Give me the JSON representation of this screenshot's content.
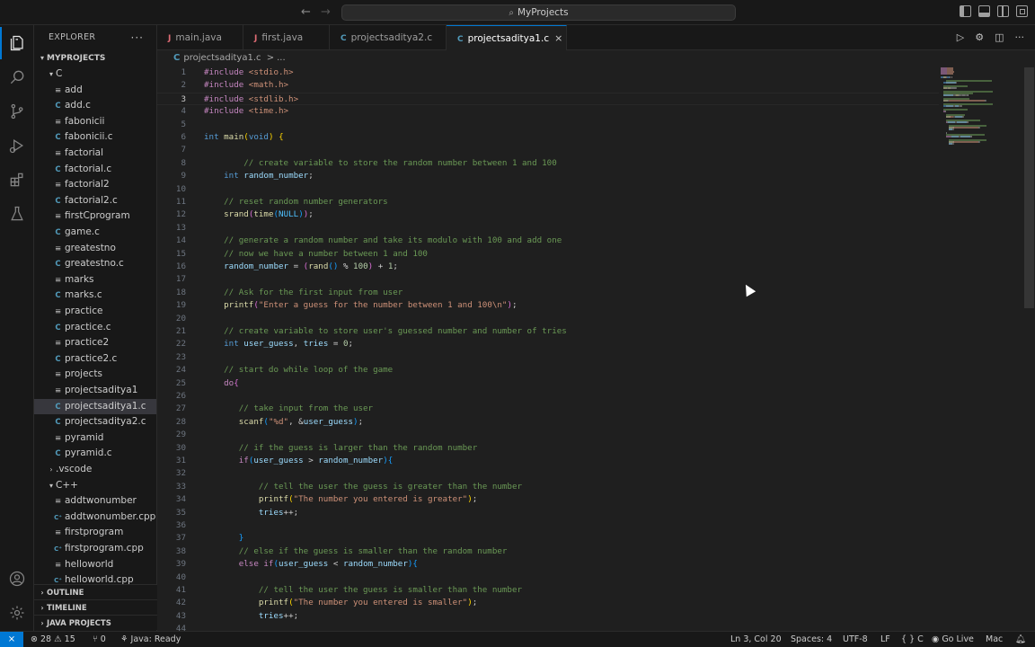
{
  "titlebar": {
    "search_text": "MyProjects",
    "back": "←",
    "forward": "→"
  },
  "activity": [
    "explorer",
    "search",
    "source-control",
    "run-debug",
    "extensions",
    "testing",
    "accounts",
    "manage"
  ],
  "sidebar": {
    "title": "EXPLORER",
    "more": "···",
    "root": "MYPROJECTS",
    "items": [
      {
        "label": "C",
        "kind": "folder",
        "open": true,
        "indent": 1
      },
      {
        "label": "add",
        "kind": "bin",
        "indent": 2
      },
      {
        "label": "add.c",
        "kind": "c",
        "indent": 2
      },
      {
        "label": "fabonicii",
        "kind": "bin",
        "indent": 2
      },
      {
        "label": "fabonicii.c",
        "kind": "c",
        "indent": 2
      },
      {
        "label": "factorial",
        "kind": "bin",
        "indent": 2
      },
      {
        "label": "factorial.c",
        "kind": "c",
        "indent": 2
      },
      {
        "label": "factorial2",
        "kind": "bin",
        "indent": 2
      },
      {
        "label": "factorial2.c",
        "kind": "c",
        "indent": 2
      },
      {
        "label": "firstCprogram",
        "kind": "bin",
        "indent": 2
      },
      {
        "label": "game.c",
        "kind": "c",
        "indent": 2
      },
      {
        "label": "greatestno",
        "kind": "bin",
        "indent": 2
      },
      {
        "label": "greatestno.c",
        "kind": "c",
        "indent": 2
      },
      {
        "label": "marks",
        "kind": "bin",
        "indent": 2
      },
      {
        "label": "marks.c",
        "kind": "c",
        "indent": 2
      },
      {
        "label": "practice",
        "kind": "bin",
        "indent": 2
      },
      {
        "label": "practice.c",
        "kind": "c",
        "indent": 2
      },
      {
        "label": "practice2",
        "kind": "bin",
        "indent": 2
      },
      {
        "label": "practice2.c",
        "kind": "c",
        "indent": 2
      },
      {
        "label": "projects",
        "kind": "bin",
        "indent": 2
      },
      {
        "label": "projectsaditya1",
        "kind": "bin",
        "indent": 2
      },
      {
        "label": "projectsaditya1.c",
        "kind": "c",
        "indent": 2,
        "selected": true
      },
      {
        "label": "projectsaditya2.c",
        "kind": "c",
        "indent": 2
      },
      {
        "label": "pyramid",
        "kind": "bin",
        "indent": 2
      },
      {
        "label": "pyramid.c",
        "kind": "c",
        "indent": 2
      },
      {
        "label": ".vscode",
        "kind": "folder",
        "open": false,
        "indent": 1
      },
      {
        "label": "C++",
        "kind": "folder",
        "open": true,
        "indent": 1
      },
      {
        "label": "addtwonumber",
        "kind": "bin",
        "indent": 2
      },
      {
        "label": "addtwonumber.cpp",
        "kind": "cpp",
        "indent": 2
      },
      {
        "label": "firstprogram",
        "kind": "bin",
        "indent": 2
      },
      {
        "label": "firstprogram.cpp",
        "kind": "cpp",
        "indent": 2
      },
      {
        "label": "helloworld",
        "kind": "bin",
        "indent": 2
      },
      {
        "label": "helloworld.cpp",
        "kind": "cpp",
        "indent": 2
      }
    ],
    "outline": "OUTLINE",
    "timeline": "TIMELINE",
    "java_projects": "JAVA PROJECTS"
  },
  "tabs": [
    {
      "label": "main.java",
      "icon": "J",
      "type": "java"
    },
    {
      "label": "first.java",
      "icon": "J",
      "type": "java"
    },
    {
      "label": "projectsaditya2.c",
      "icon": "C",
      "type": "c"
    },
    {
      "label": "projectsaditya1.c",
      "icon": "C",
      "type": "c",
      "active": true
    }
  ],
  "tab_close": "×",
  "breadcrumb": {
    "lang_icon": "C",
    "file": "projectsaditya1.c",
    "sep": ">",
    "more": "..."
  },
  "editor": {
    "current_line": 3,
    "lines": [
      [
        [
          "pp",
          "#include "
        ],
        [
          "str",
          "<stdio.h>"
        ]
      ],
      [
        [
          "pp",
          "#include "
        ],
        [
          "str",
          "<math.h>"
        ]
      ],
      [
        [
          "pp",
          "#include "
        ],
        [
          "str",
          "<stdlib.h>"
        ]
      ],
      [
        [
          "pp",
          "#include "
        ],
        [
          "str",
          "<time.h>"
        ]
      ],
      [],
      [
        [
          "kw",
          "int "
        ],
        [
          "fn",
          "main"
        ],
        [
          "paren",
          "("
        ],
        [
          "kw",
          "void"
        ],
        [
          "paren",
          ")"
        ],
        [
          "txt",
          " "
        ],
        [
          "paren",
          "{"
        ]
      ],
      [],
      [
        [
          "txt",
          "        "
        ],
        [
          "cm",
          "// create variable to store the random number between 1 and 100"
        ]
      ],
      [
        [
          "txt",
          "    "
        ],
        [
          "kw",
          "int "
        ],
        [
          "var",
          "random_number"
        ],
        [
          "txt",
          ";"
        ]
      ],
      [],
      [
        [
          "txt",
          "    "
        ],
        [
          "cm",
          "// reset random number generators"
        ]
      ],
      [
        [
          "txt",
          "    "
        ],
        [
          "fn",
          "srand"
        ],
        [
          "paren2",
          "("
        ],
        [
          "fn",
          "time"
        ],
        [
          "paren3",
          "("
        ],
        [
          "mac",
          "NULL"
        ],
        [
          "paren3",
          ")"
        ],
        [
          "paren2",
          ")"
        ],
        [
          "txt",
          ";"
        ]
      ],
      [],
      [
        [
          "txt",
          "    "
        ],
        [
          "cm",
          "// generate a random number and take its modulo with 100 and add one"
        ]
      ],
      [
        [
          "txt",
          "    "
        ],
        [
          "cm",
          "// now we have a number between 1 and 100"
        ]
      ],
      [
        [
          "txt",
          "    "
        ],
        [
          "var",
          "random_number"
        ],
        [
          "txt",
          " = "
        ],
        [
          "paren2",
          "("
        ],
        [
          "fn",
          "rand"
        ],
        [
          "paren3",
          "()"
        ],
        [
          "txt",
          " % "
        ],
        [
          "num",
          "100"
        ],
        [
          "paren2",
          ")"
        ],
        [
          "txt",
          " + "
        ],
        [
          "num",
          "1"
        ],
        [
          "txt",
          ";"
        ]
      ],
      [],
      [
        [
          "txt",
          "    "
        ],
        [
          "cm",
          "// Ask for the first input from user"
        ]
      ],
      [
        [
          "txt",
          "    "
        ],
        [
          "fn",
          "printf"
        ],
        [
          "paren2",
          "("
        ],
        [
          "str",
          "\"Enter a guess for the number between 1 and 100\\n\""
        ],
        [
          "paren2",
          ")"
        ],
        [
          "txt",
          ";"
        ]
      ],
      [],
      [
        [
          "txt",
          "    "
        ],
        [
          "cm",
          "// create variable to store user's guessed number and number of tries"
        ]
      ],
      [
        [
          "txt",
          "    "
        ],
        [
          "kw",
          "int "
        ],
        [
          "var",
          "user_guess"
        ],
        [
          "txt",
          ", "
        ],
        [
          "var",
          "tries"
        ],
        [
          "txt",
          " = "
        ],
        [
          "num",
          "0"
        ],
        [
          "txt",
          ";"
        ]
      ],
      [],
      [
        [
          "txt",
          "    "
        ],
        [
          "cm",
          "// start do while loop of the game"
        ]
      ],
      [
        [
          "txt",
          "    "
        ],
        [
          "pp",
          "do"
        ],
        [
          "paren2",
          "{"
        ]
      ],
      [],
      [
        [
          "txt",
          "       "
        ],
        [
          "cm",
          "// take input from the user"
        ]
      ],
      [
        [
          "txt",
          "       "
        ],
        [
          "fn",
          "scanf"
        ],
        [
          "paren3",
          "("
        ],
        [
          "str",
          "\"%d\""
        ],
        [
          "txt",
          ", &"
        ],
        [
          "var",
          "user_guess"
        ],
        [
          "paren3",
          ")"
        ],
        [
          "txt",
          ";"
        ]
      ],
      [],
      [
        [
          "txt",
          "       "
        ],
        [
          "cm",
          "// if the guess is larger than the random number"
        ]
      ],
      [
        [
          "txt",
          "       "
        ],
        [
          "pp",
          "if"
        ],
        [
          "paren3",
          "("
        ],
        [
          "var",
          "user_guess"
        ],
        [
          "txt",
          " > "
        ],
        [
          "var",
          "random_number"
        ],
        [
          "paren3",
          ")"
        ],
        [
          "paren3",
          "{"
        ]
      ],
      [],
      [
        [
          "txt",
          "           "
        ],
        [
          "cm",
          "// tell the user the guess is greater than the number"
        ]
      ],
      [
        [
          "txt",
          "           "
        ],
        [
          "fn",
          "printf"
        ],
        [
          "paren",
          "("
        ],
        [
          "str",
          "\"The number you entered is greater\""
        ],
        [
          "paren",
          ")"
        ],
        [
          "txt",
          ";"
        ]
      ],
      [
        [
          "txt",
          "           "
        ],
        [
          "var",
          "tries"
        ],
        [
          "txt",
          "++;"
        ]
      ],
      [],
      [
        [
          "txt",
          "       "
        ],
        [
          "paren3",
          "}"
        ]
      ],
      [
        [
          "txt",
          "       "
        ],
        [
          "cm",
          "// else if the guess is smaller than the random number"
        ]
      ],
      [
        [
          "txt",
          "       "
        ],
        [
          "pp",
          "else if"
        ],
        [
          "paren3",
          "("
        ],
        [
          "var",
          "user_guess"
        ],
        [
          "txt",
          " < "
        ],
        [
          "var",
          "random_number"
        ],
        [
          "paren3",
          ")"
        ],
        [
          "paren3",
          "{"
        ]
      ],
      [],
      [
        [
          "txt",
          "           "
        ],
        [
          "cm",
          "// tell the user the guess is smaller than the number"
        ]
      ],
      [
        [
          "txt",
          "           "
        ],
        [
          "fn",
          "printf"
        ],
        [
          "paren",
          "("
        ],
        [
          "str",
          "\"The number you entered is smaller\""
        ],
        [
          "paren",
          ")"
        ],
        [
          "txt",
          ";"
        ]
      ],
      [
        [
          "txt",
          "           "
        ],
        [
          "var",
          "tries"
        ],
        [
          "txt",
          "++;"
        ]
      ],
      []
    ]
  },
  "statusbar": {
    "remote": "⨯",
    "errors": "28",
    "warnings": "15",
    "ports": "0",
    "java_status": "Java: Ready",
    "position": "Ln 3, Col 20",
    "spaces": "Spaces: 4",
    "encoding": "UTF-8",
    "eol": "LF",
    "language": "C",
    "golive": "Go Live",
    "platform": "Mac"
  }
}
